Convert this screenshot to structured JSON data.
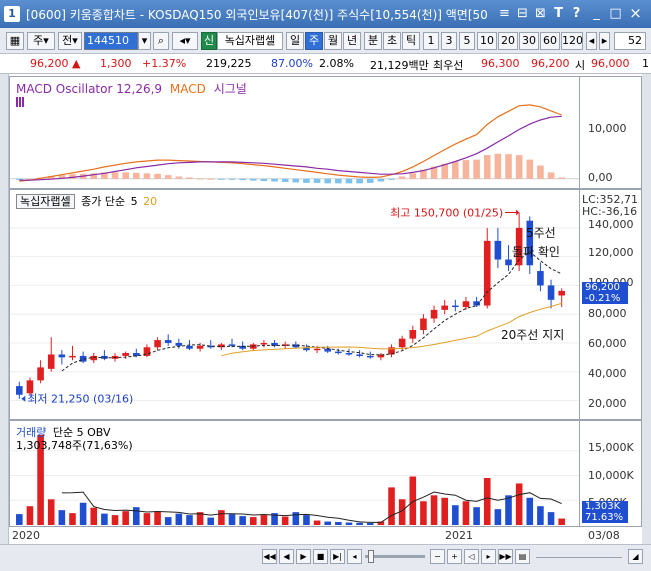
{
  "window": {
    "title": "[0600] 키움종합차트 - KOSDAQ150 외국인보유[407(천)] 주식수[10,554(천)] 액면[50",
    "app_icon": "1",
    "controls": [
      "≡",
      "⊟",
      "⊠",
      "T",
      "?",
      "_",
      "□",
      "×"
    ]
  },
  "toolbar": {
    "period_label": "주",
    "type_label": "전",
    "code_value": "144510",
    "indicator_badge": "신",
    "indicator_name": "녹십자랩셀",
    "intervals": [
      "일",
      "주",
      "월",
      "년",
      "분",
      "초",
      "틱"
    ],
    "active_interval": "주",
    "minute_steps": [
      "1",
      "3",
      "5",
      "10",
      "20",
      "30",
      "60",
      "120"
    ],
    "count_value": "52"
  },
  "price": {
    "current": "96,200",
    "change": "1,300",
    "change_pct": "+1.37%",
    "volume": "219,225",
    "ratio": "87.00%",
    "turnover": "2.08%",
    "amount": "21,129백만",
    "best_ask_label": "최우선",
    "best_ask": "96,300",
    "best_bid": "96,200",
    "open_label": "시",
    "open": "96,000",
    "extra": "1"
  },
  "macd_panel": {
    "title": "MACD Oscillator 12,26,9",
    "macd_label": "MACD",
    "signal_label": "시그널",
    "axis_labels": [
      "10,000",
      "0,00"
    ],
    "colors": {
      "macd": "#e8701a",
      "signal": "#8a2aa8",
      "osc_pos": "#f7b49c",
      "osc_neg": "#7cc2ec"
    }
  },
  "price_panel": {
    "stock_name": "녹십자랩셀",
    "ma_label": "종가 단순",
    "ma5": "5",
    "ma20": "20",
    "lc": "LC:352,71",
    "hc": "HC:-36,16",
    "current_price": "96,200",
    "current_pct": "-0.21%",
    "axis_labels": [
      "140,000",
      "120,000",
      "100,000",
      "80,000",
      "60,000",
      "40,000",
      "20,000"
    ],
    "high_note": "최고 150,700 (01/25)",
    "low_note": "최저 21,250 (03/16)",
    "annotation_ma5_line1": "5주선",
    "annotation_ma5_line2": "돌파 확인",
    "annotation_ma20": "20주선 지지",
    "colors": {
      "up": "#e02020",
      "down": "#1f4fd0",
      "ma5": "#222222",
      "ma20": "#e0a020"
    }
  },
  "volume_panel": {
    "title": "거래량",
    "ma_label": "단순 5",
    "obv_label": "OBV",
    "info": "1,303,748주(71,63%)",
    "axis_labels": [
      "15,000K",
      "10,000K",
      "5,000K"
    ],
    "current_volume": "1,303K",
    "current_pct": "71.63%"
  },
  "x_axis": {
    "labels": [
      "2020",
      "2021",
      "03/08"
    ]
  },
  "chart_data": {
    "type": "candlestick",
    "price_ylim": [
      12000,
      158000
    ],
    "volume_ylim": [
      0,
      19000
    ],
    "weeks": [
      {
        "o": 30000,
        "h": 33000,
        "l": 21250,
        "c": 24000
      },
      {
        "o": 25000,
        "h": 36000,
        "l": 24000,
        "c": 34000
      },
      {
        "o": 34000,
        "h": 48000,
        "l": 32000,
        "c": 43000
      },
      {
        "o": 42000,
        "h": 64000,
        "l": 40000,
        "c": 52000
      },
      {
        "o": 52000,
        "h": 55000,
        "l": 45000,
        "c": 50000
      },
      {
        "o": 50000,
        "h": 58000,
        "l": 48000,
        "c": 51000
      },
      {
        "o": 51000,
        "h": 54000,
        "l": 46000,
        "c": 47000
      },
      {
        "o": 48000,
        "h": 53000,
        "l": 46000,
        "c": 51000
      },
      {
        "o": 51000,
        "h": 55000,
        "l": 48000,
        "c": 49000
      },
      {
        "o": 49000,
        "h": 53000,
        "l": 47000,
        "c": 51000
      },
      {
        "o": 51000,
        "h": 54000,
        "l": 49000,
        "c": 53000
      },
      {
        "o": 53000,
        "h": 56000,
        "l": 50000,
        "c": 51000
      },
      {
        "o": 51000,
        "h": 59000,
        "l": 50000,
        "c": 57000
      },
      {
        "o": 57000,
        "h": 64000,
        "l": 55000,
        "c": 62000
      },
      {
        "o": 62000,
        "h": 66000,
        "l": 58000,
        "c": 60000
      },
      {
        "o": 60000,
        "h": 63000,
        "l": 56000,
        "c": 58000
      },
      {
        "o": 58000,
        "h": 62000,
        "l": 55000,
        "c": 56000
      },
      {
        "o": 56000,
        "h": 60000,
        "l": 54000,
        "c": 58000
      },
      {
        "o": 58000,
        "h": 62000,
        "l": 56000,
        "c": 57000
      },
      {
        "o": 57000,
        "h": 60000,
        "l": 55000,
        "c": 59000
      },
      {
        "o": 59000,
        "h": 63000,
        "l": 57000,
        "c": 58000
      },
      {
        "o": 58000,
        "h": 61000,
        "l": 55000,
        "c": 56000
      },
      {
        "o": 56000,
        "h": 60000,
        "l": 55000,
        "c": 59000
      },
      {
        "o": 59000,
        "h": 62000,
        "l": 57000,
        "c": 60000
      },
      {
        "o": 60000,
        "h": 62000,
        "l": 57000,
        "c": 58000
      },
      {
        "o": 58000,
        "h": 61000,
        "l": 56000,
        "c": 59000
      },
      {
        "o": 59000,
        "h": 61000,
        "l": 56000,
        "c": 57000
      },
      {
        "o": 57000,
        "h": 59000,
        "l": 54000,
        "c": 55000
      },
      {
        "o": 55000,
        "h": 58000,
        "l": 53000,
        "c": 56000
      },
      {
        "o": 56000,
        "h": 58000,
        "l": 53000,
        "c": 54000
      },
      {
        "o": 54000,
        "h": 56000,
        "l": 52000,
        "c": 53000
      },
      {
        "o": 53000,
        "h": 56000,
        "l": 51000,
        "c": 52000
      },
      {
        "o": 52000,
        "h": 55000,
        "l": 50000,
        "c": 51000
      },
      {
        "o": 51000,
        "h": 54000,
        "l": 49000,
        "c": 50000
      },
      {
        "o": 50000,
        "h": 53000,
        "l": 48000,
        "c": 52000
      },
      {
        "o": 52000,
        "h": 59000,
        "l": 50000,
        "c": 57000
      },
      {
        "o": 57000,
        "h": 65000,
        "l": 55000,
        "c": 63000
      },
      {
        "o": 63000,
        "h": 72000,
        "l": 60000,
        "c": 69000
      },
      {
        "o": 69000,
        "h": 80000,
        "l": 66000,
        "c": 77000
      },
      {
        "o": 77000,
        "h": 86000,
        "l": 74000,
        "c": 83000
      },
      {
        "o": 83000,
        "h": 90000,
        "l": 80000,
        "c": 86000
      },
      {
        "o": 86000,
        "h": 90000,
        "l": 82000,
        "c": 85000
      },
      {
        "o": 85000,
        "h": 92000,
        "l": 83000,
        "c": 89000
      },
      {
        "o": 89000,
        "h": 92000,
        "l": 85000,
        "c": 86000
      },
      {
        "o": 86000,
        "h": 140000,
        "l": 84000,
        "c": 131000
      },
      {
        "o": 131000,
        "h": 140000,
        "l": 112000,
        "c": 118000
      },
      {
        "o": 118000,
        "h": 128000,
        "l": 110000,
        "c": 114000
      },
      {
        "o": 114000,
        "h": 150700,
        "l": 110000,
        "c": 140000
      },
      {
        "o": 145000,
        "h": 148000,
        "l": 108000,
        "c": 114000
      },
      {
        "o": 110000,
        "h": 116000,
        "l": 96000,
        "c": 100000
      },
      {
        "o": 100000,
        "h": 104000,
        "l": 84000,
        "c": 90000
      },
      {
        "o": 93000,
        "h": 98000,
        "l": 85000,
        "c": 96200
      }
    ],
    "volume": [
      2200,
      3800,
      18200,
      5200,
      3000,
      2400,
      4500,
      3500,
      2300,
      2000,
      2800,
      3600,
      2400,
      2800,
      1600,
      2300,
      2000,
      2600,
      1500,
      3000,
      2200,
      1800,
      1600,
      2000,
      2400,
      1700,
      2600,
      2000,
      900,
      700,
      600,
      500,
      450,
      400,
      700,
      7600,
      5200,
      9800,
      4800,
      6000,
      5500,
      4000,
      4800,
      3600,
      9500,
      3200,
      6000,
      8400,
      5500,
      3800,
      2600,
      1303
    ],
    "macd": [
      -500,
      -300,
      100,
      500,
      900,
      1300,
      1700,
      2100,
      2600,
      3000,
      3400,
      3700,
      3900,
      4100,
      4100,
      4000,
      3900,
      3800,
      3700,
      3600,
      3500,
      3300,
      3100,
      2900,
      2600,
      2300,
      2000,
      1700,
      1400,
      1100,
      800,
      600,
      400,
      300,
      400,
      900,
      1600,
      2600,
      3800,
      5100,
      6400,
      7600,
      8700,
      9700,
      11900,
      13600,
      14800,
      16000,
      16200,
      15800,
      14900,
      14000
    ],
    "signal": [
      -300,
      -300,
      -200,
      -100,
      100,
      300,
      600,
      900,
      1200,
      1600,
      2000,
      2400,
      2700,
      3000,
      3300,
      3500,
      3600,
      3700,
      3700,
      3700,
      3700,
      3600,
      3500,
      3400,
      3200,
      3000,
      2800,
      2600,
      2300,
      2100,
      1800,
      1600,
      1400,
      1200,
      1000,
      1000,
      1100,
      1400,
      1800,
      2400,
      3100,
      3800,
      4600,
      5500,
      6700,
      8100,
      9400,
      10800,
      12000,
      12900,
      13500,
      13700
    ]
  }
}
